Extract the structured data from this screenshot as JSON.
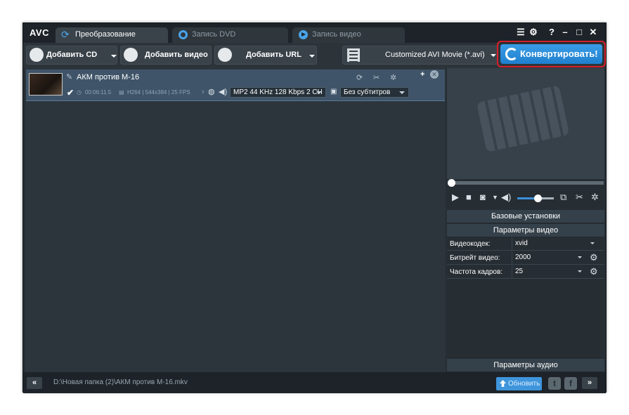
{
  "app": {
    "logo": "AVC"
  },
  "tabs": [
    {
      "label": "Преобразование",
      "active": true,
      "icon": "convert-icon"
    },
    {
      "label": "Запись DVD",
      "active": false,
      "icon": "disc-icon"
    },
    {
      "label": "Запись видео",
      "active": false,
      "icon": "play-icon"
    }
  ],
  "window_controls": {
    "help": "?",
    "minimize": "minimize-icon",
    "maximize": "maximize-icon",
    "close": "close-icon"
  },
  "toolbar": {
    "add_cd": "Добавить CD диск",
    "add_video": "Добавить видео",
    "add_url": "Добавить URL",
    "profile": "Customized AVI Movie (*.avi)",
    "convert": "Конвертировать!"
  },
  "file": {
    "name": "АКМ против М-16",
    "checked": true,
    "duration": "00:06:11.5",
    "video_info": "H264 | 544x384 | 25 FPS",
    "audio_track": "MP2 44 KHz 128 Kbps 2 CH",
    "subtitles": "Без субтитров"
  },
  "settings": {
    "basic": "Базовые установки",
    "video_params": "Параметры видео",
    "audio_params": "Параметры аудио",
    "props": [
      {
        "key": "Видеокодек:",
        "value": "xvid",
        "gear": false
      },
      {
        "key": "Битрейт видео:",
        "value": "2000",
        "gear": true
      },
      {
        "key": "Частота кадров:",
        "value": "25",
        "gear": true
      }
    ]
  },
  "player": {
    "seek_position": 0.0,
    "volume_level": 0.55
  },
  "status": {
    "collapse": "«",
    "path": "D:\\Новая папка (2)\\АКМ против М-16.mkv",
    "update": "Обновить",
    "twitter": "t",
    "facebook": "f",
    "expand": "»"
  },
  "colors": {
    "accent": "#2f8fe0",
    "highlight_border": "#d8202a",
    "selected_row": "#3f5468"
  }
}
